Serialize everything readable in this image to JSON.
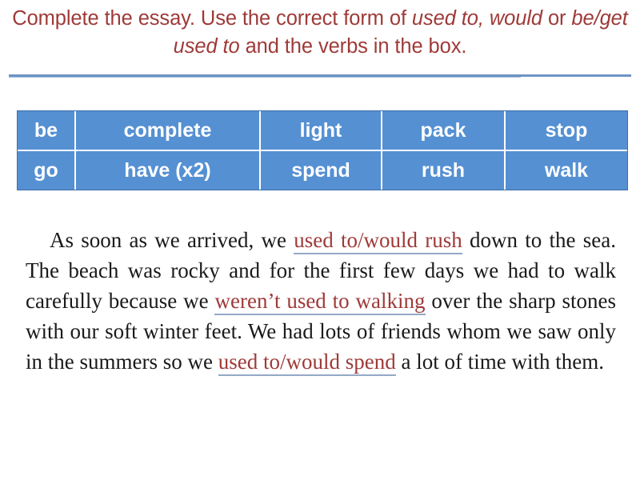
{
  "slide": {
    "instruction": {
      "segment_1": "Complete the essay. Use the correct form of ",
      "emphasis_1": "used to, would",
      "segment_2": " or ",
      "emphasis_2": "be/get used to",
      "segment_3": " and the verbs in the box."
    },
    "colors": {
      "title_red": "#9E3A38",
      "table_blue": "#5590D3",
      "divider_blue": "#6E94C4",
      "answer_red": "#9E3A38",
      "underline_blue": "#93A9C6"
    }
  },
  "word_bank": {
    "rows": [
      [
        "be",
        "complete",
        "light",
        "pack",
        "stop"
      ],
      [
        "go",
        "have (x2)",
        "spend",
        "rush",
        "walk"
      ]
    ]
  },
  "essay": {
    "part_1": "As soon as we arrived, we ",
    "answer_1": "used to/would rush",
    "part_2": " down to the sea. The beach was rocky and for the first few days we had to walk carefully because we ",
    "answer_2": "weren’t used to walking",
    "part_3": " over the sharp stones with our soft winter feet. We had lots of friends whom we saw only in the summers so we ",
    "answer_3": "used to/would spend",
    "part_4": " a lot of time with them."
  }
}
